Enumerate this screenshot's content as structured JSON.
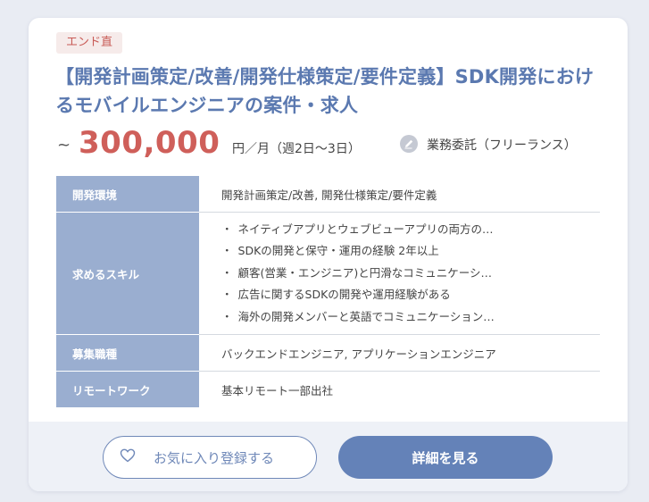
{
  "job": {
    "badge": "エンド直",
    "title": "【開発計画策定/改善/開発仕様策定/要件定義】SDK開発におけるモバイルエンジニアの案件・求人",
    "price_prefix": "~",
    "price_amount": "300,000",
    "price_unit": "円／月（週2日〜3日）",
    "contract_type": "業務委託（フリーランス）",
    "contract_icon": "pencil-icon"
  },
  "specs": {
    "env_label": "開発環境",
    "env_value": "開発計画策定/改善, 開発仕様策定/要件定義",
    "skills_label": "求めるスキル",
    "skills": [
      "ネイティブアプリとウェブビューアプリの両方の…",
      "SDKの開発と保守・運用の経験 2年以上",
      "顧客(営業・エンジニア)と円滑なコミュニケーシ…",
      "広告に関するSDKの開発や運用経験がある",
      "海外の開発メンバーと英語でコミュニケーション…"
    ],
    "bullet": "・",
    "role_label": "募集職種",
    "role_value": "バックエンドエンジニア, アプリケーションエンジニア",
    "remote_label": "リモートワーク",
    "remote_value": "基本リモート一部出社"
  },
  "actions": {
    "favorite_label": "お気に入り登録する",
    "favorite_icon": "heart-icon",
    "detail_label": "詳細を見る"
  },
  "colors": {
    "accent": "#6482b8",
    "title": "#5b79b0",
    "price": "#cf5f5a",
    "header_cell": "#9aaed0"
  }
}
